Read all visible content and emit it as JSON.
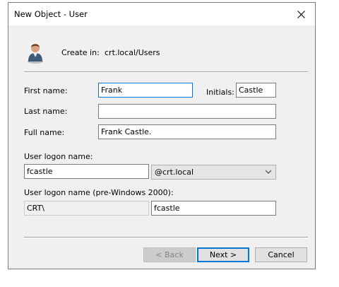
{
  "window": {
    "title": "New Object - User",
    "close_icon": "close-icon"
  },
  "header": {
    "icon": "user-icon",
    "create_in_label": "Create in:",
    "create_in_value": "crt.local/Users"
  },
  "form": {
    "first_name_label": "First name:",
    "first_name_value": "Frank",
    "initials_label": "Initials:",
    "initials_value": "Castle",
    "last_name_label": "Last name:",
    "last_name_value": "",
    "full_name_label": "Full name:",
    "full_name_value": "Frank Castle.",
    "logon_name_label": "User logon name:",
    "logon_name_value": "fcastle",
    "domain_value": "@crt.local",
    "pre2000_label": "User logon name (pre-Windows 2000):",
    "pre2000_domain_value": "CRT\\",
    "pre2000_name_value": "fcastle"
  },
  "buttons": {
    "back_label": "< Back",
    "next_label": "Next >",
    "cancel_label": "Cancel"
  },
  "colors": {
    "focus_border": "#0078d7",
    "dialog_bg": "#f0f0f0"
  }
}
